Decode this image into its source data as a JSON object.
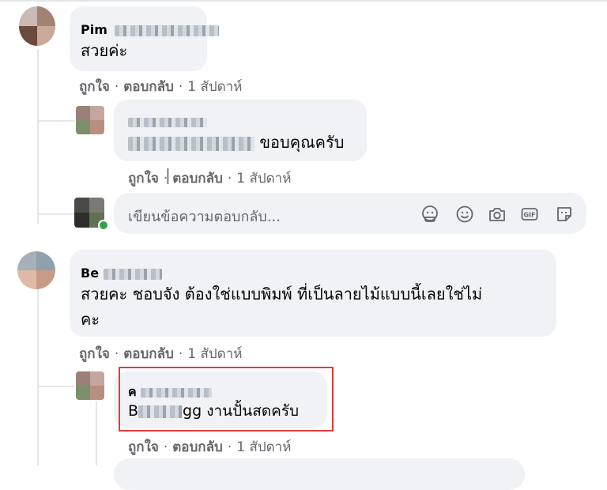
{
  "comments": [
    {
      "author": "Pim",
      "text": "สวยค่ะ",
      "actions": {
        "like": "ถูกใจ",
        "reply": "ตอบกลับ",
        "time": "1 สัปดาห์"
      }
    },
    {
      "author": "",
      "text_suffix": "ขอบคุณครับ",
      "actions": {
        "like": "ถูกใจ",
        "reply": "ตอบกลับ",
        "time": "1 สัปดาห์"
      }
    },
    {
      "author": "Be",
      "text_line1": "สวยคะ ชอบจัง ต้องใช่แบบพิมพ์ ที่เป็นลายไม้แบบนี้เลยใช่ไม่",
      "text_line2": "คะ",
      "actions": {
        "like": "ถูกใจ",
        "reply": "ตอบกลับ",
        "time": "1 สัปดาห์"
      }
    },
    {
      "author": "ค",
      "text_prefix": "B",
      "text_mid": "gg",
      "text_suffix": "งานปั้นสดครับ",
      "actions": {
        "like": "ถูกใจ",
        "reply": "ตอบกลับ",
        "time": "1 สัปดาห์"
      }
    }
  ],
  "reply_box": {
    "placeholder": "เขียนข้อความตอบกลับ...",
    "icons": [
      "avatar-sticker-icon",
      "emoji-icon",
      "camera-icon",
      "gif-icon",
      "sticker-icon"
    ]
  },
  "separator": "·",
  "colors": {
    "bubble": "#f0f2f5",
    "secondary_text": "#65676b",
    "highlight": "#e03c3c"
  }
}
